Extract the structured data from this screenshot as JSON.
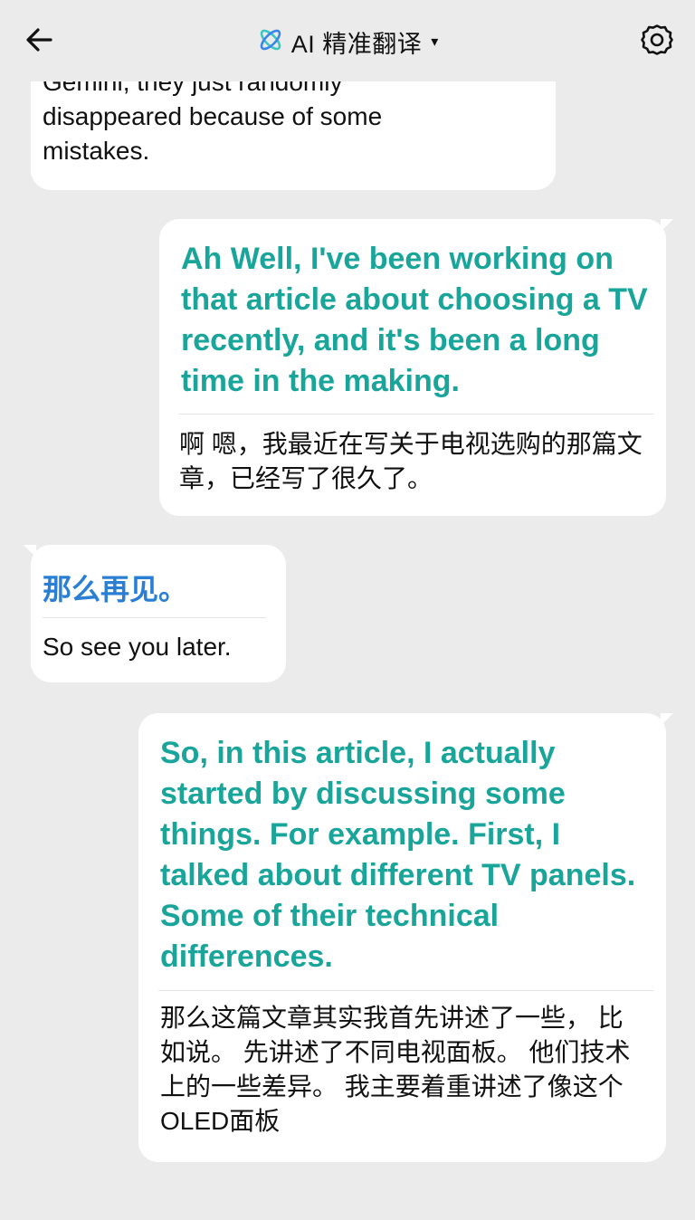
{
  "header": {
    "title": "AI 精准翻译",
    "caret": "▾",
    "colors": {
      "logo_primary": "#3cc8c0",
      "logo_secondary": "#3a86e8"
    }
  },
  "messages": [
    {
      "side": "left",
      "text": "Gemini, they just randomly disappeared because of some mistakes."
    },
    {
      "side": "right",
      "original": "Ah Well, I've been working on that article about choosing a TV recently, and it's been a long time in the making.",
      "translation": "啊 嗯，我最近在写关于电视选购的那篇文章，已经写了很久了。"
    },
    {
      "side": "left",
      "original": "那么再见。",
      "translation": "So see you later."
    },
    {
      "side": "right",
      "original": "So, in this article, I actually started by discussing some things. For example. First, I talked about different TV panels. Some of their technical differences.",
      "translation": "那么这篇文章其实我首先讲述了一些， 比如说。 先讲述了不同电视面板。 他们技术上的一些差异。 我主要着重讲述了像这个OLED面板"
    }
  ],
  "colors": {
    "background": "#ebebeb",
    "bubble": "#ffffff",
    "english_highlight": "#1aa59a",
    "chinese_highlight": "#2a7fd4"
  }
}
